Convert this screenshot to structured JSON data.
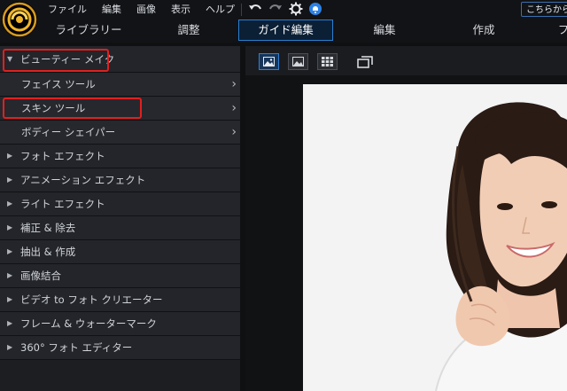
{
  "menu": [
    "ファイル",
    "編集",
    "画像",
    "表示",
    "ヘルプ"
  ],
  "notice_label": "こちらから ...",
  "tabs": [
    {
      "label": "ライブラリー"
    },
    {
      "label": "調整"
    },
    {
      "label": "ガイド編集"
    },
    {
      "label": "編集"
    },
    {
      "label": "作成"
    },
    {
      "label": "フ"
    }
  ],
  "active_tab": "ガイド編集",
  "panel": {
    "section_open": {
      "label": "ビューティー メイク"
    },
    "subitems": [
      {
        "label": "フェイス ツール"
      },
      {
        "label": "スキン ツール"
      },
      {
        "label": "ボディー シェイパー"
      }
    ],
    "sections": [
      {
        "label": "フォト エフェクト"
      },
      {
        "label": "アニメーション エフェクト"
      },
      {
        "label": "ライト エフェクト"
      },
      {
        "label": "補正 & 除去"
      },
      {
        "label": "抽出 & 作成"
      },
      {
        "label": "画像結合"
      },
      {
        "label": "ビデオ to フォト クリエーター"
      },
      {
        "label": "フレーム & ウォーターマーク"
      },
      {
        "label": "360° フォト エディター"
      }
    ]
  },
  "icons": {
    "logo": "app-logo-icon",
    "undo": "undo-icon",
    "redo": "redo-icon",
    "settings": "gear-icon",
    "notification": "bell-icon",
    "view_single": "single-view-icon",
    "view_compare": "compare-view-icon",
    "view_grid": "grid-view-icon",
    "detach": "detach-window-icon"
  },
  "colors": {
    "accent_blue": "#2b7fd1",
    "highlight_red": "#e0201f",
    "panel_bg": "#1d1e22"
  }
}
